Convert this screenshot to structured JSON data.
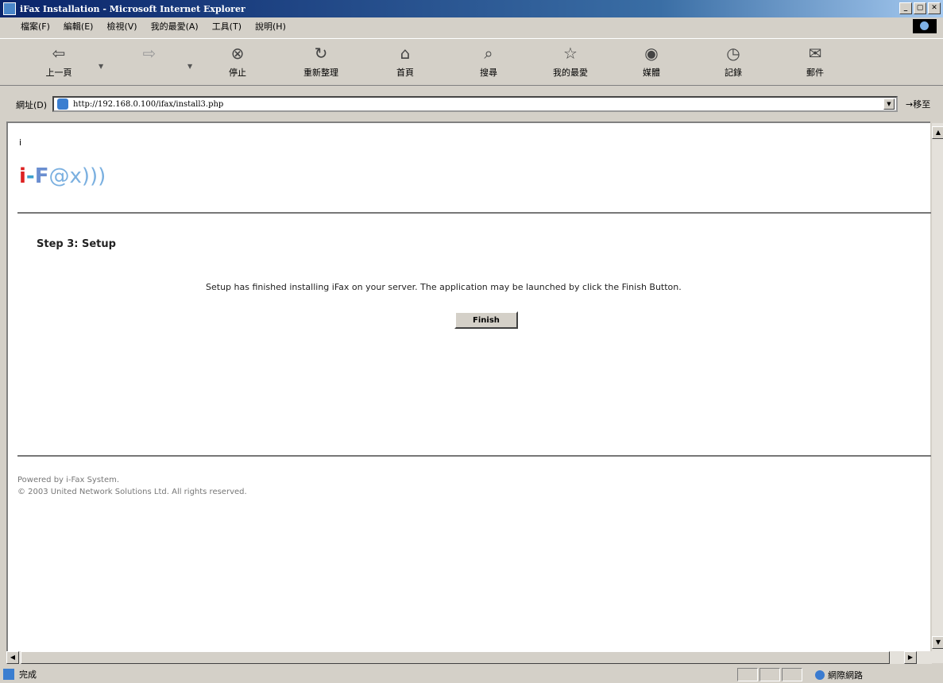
{
  "window": {
    "title": "iFax Installation - Microsoft Internet Explorer",
    "buttons": {
      "minimize": "_",
      "maximize": "▢",
      "close": "✕"
    }
  },
  "menu": [
    "檔案(F)",
    "編輯(E)",
    "檢視(V)",
    "我的最愛(A)",
    "工具(T)",
    "說明(H)"
  ],
  "toolbar": {
    "back": "上一頁",
    "forward": "",
    "stop": "停止",
    "refresh": "重新整理",
    "home": "首頁",
    "search": "搜尋",
    "favorites": "我的最愛",
    "media": "媒體",
    "history": "記錄",
    "mail": "郵件"
  },
  "address": {
    "label": "網址(D)",
    "url": "http://192.168.0.100/ifax/install3.php",
    "go": "移至"
  },
  "page": {
    "corner_mark": "i",
    "logo": {
      "i": "i",
      "dash": "-",
      "f": "F",
      "rest": "@x)))"
    },
    "step_title": "Step 3: Setup",
    "message": "Setup has finished installing iFax on your server. The application may be launched by click the Finish Button.",
    "finish_button": "Finish",
    "footer_line1": "Powered by i-Fax System.",
    "footer_line2": "© 2003 United Network Solutions Ltd. All rights reserved."
  },
  "status": {
    "text": "完成",
    "zone": "網際網路"
  }
}
